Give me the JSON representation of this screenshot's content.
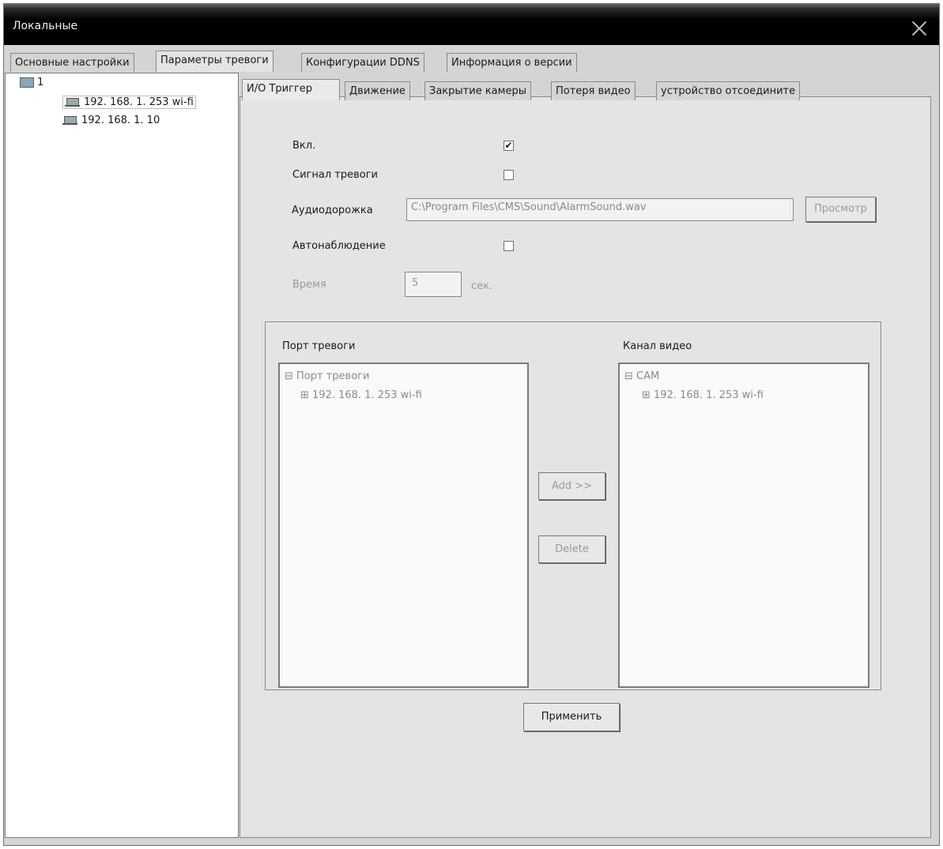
{
  "window": {
    "title": "Локальные",
    "close_icon": "close-icon"
  },
  "top_tabs": [
    {
      "label": "Основные настройки"
    },
    {
      "label": "Параметры тревоги"
    },
    {
      "label": "Конфигурации DDNS"
    },
    {
      "label": "Информация о версии"
    }
  ],
  "device_tree": {
    "root": "1",
    "devices": [
      "192. 168. 1. 253 wi-fi",
      "192. 168. 1. 10"
    ]
  },
  "sub_tabs": [
    {
      "label": "И/О Триггер"
    },
    {
      "label": "Движение"
    },
    {
      "label": "Закрытие камеры"
    },
    {
      "label": "Потеря видео"
    },
    {
      "label": "устройство отсоедините"
    }
  ],
  "form": {
    "enable_label": "Вкл.",
    "enable_checked": "✔",
    "alarm_signal_label": "Сигнал тревоги",
    "audio_label": "Аудиодорожка",
    "audio_path": "C:\\Program Files\\CMS\\Sound\\AlarmSound.wav",
    "browse_button": "Просмотр",
    "auto_watch_label": "Автонаблюдение",
    "time_label": "Время",
    "time_value": "5",
    "time_unit": "сек."
  },
  "alarm_port": {
    "title": "Порт тревоги",
    "root": "⊟ Порт тревоги",
    "child": "⊞ 192. 168. 1. 253 wi-fi"
  },
  "video_channel": {
    "title": "Канал видео",
    "root": "⊟ CAM",
    "child": "⊞ 192. 168. 1. 253 wi-fi"
  },
  "buttons": {
    "add": "Add >>",
    "delete": "Delete",
    "apply": "Применить"
  }
}
